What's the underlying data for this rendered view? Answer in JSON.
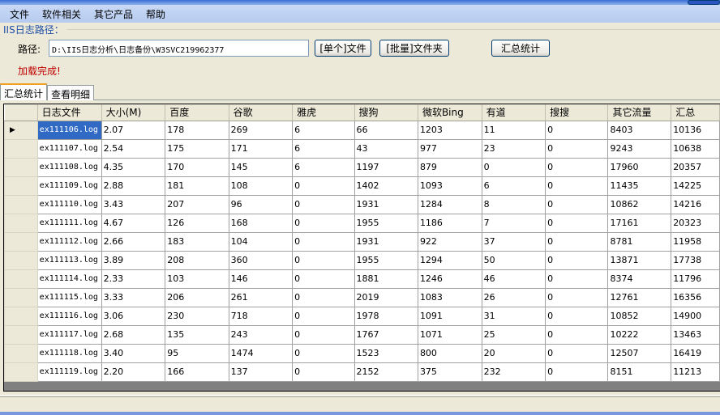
{
  "menu": [
    "文件",
    "软件相关",
    "其它产品",
    "帮助"
  ],
  "group_label": "IIS日志路径：",
  "path_label": "路径:",
  "path_value": "D:\\IIS日志分析\\日志备份\\W3SVC219962377",
  "buttons": {
    "single": "[单个]文件",
    "batch": "[批量]文件夹",
    "summary": "汇总统计"
  },
  "status": "加载完成!",
  "tabs": [
    "汇总统计",
    "查看明细"
  ],
  "columns": [
    "日志文件",
    "大小(M)",
    "百度",
    "谷歌",
    "雅虎",
    "搜狗",
    "微软Bing",
    "有道",
    "搜搜",
    "其它流量",
    "汇总"
  ],
  "rows": [
    [
      "ex111106.log",
      "2.07",
      "178",
      "269",
      "6",
      "66",
      "1203",
      "11",
      "0",
      "8403",
      "10136"
    ],
    [
      "ex111107.log",
      "2.54",
      "175",
      "171",
      "6",
      "43",
      "977",
      "23",
      "0",
      "9243",
      "10638"
    ],
    [
      "ex111108.log",
      "4.35",
      "170",
      "145",
      "6",
      "1197",
      "879",
      "0",
      "0",
      "17960",
      "20357"
    ],
    [
      "ex111109.log",
      "2.88",
      "181",
      "108",
      "0",
      "1402",
      "1093",
      "6",
      "0",
      "11435",
      "14225"
    ],
    [
      "ex111110.log",
      "3.43",
      "207",
      "96",
      "0",
      "1931",
      "1284",
      "8",
      "0",
      "10862",
      "14216"
    ],
    [
      "ex111111.log",
      "4.67",
      "126",
      "168",
      "0",
      "1955",
      "1186",
      "7",
      "0",
      "17161",
      "20323"
    ],
    [
      "ex111112.log",
      "2.66",
      "183",
      "104",
      "0",
      "1931",
      "922",
      "37",
      "0",
      "8781",
      "11958"
    ],
    [
      "ex111113.log",
      "3.89",
      "208",
      "360",
      "0",
      "1955",
      "1294",
      "50",
      "0",
      "13871",
      "17738"
    ],
    [
      "ex111114.log",
      "2.33",
      "103",
      "146",
      "0",
      "1881",
      "1246",
      "46",
      "0",
      "8374",
      "11796"
    ],
    [
      "ex111115.log",
      "3.33",
      "206",
      "261",
      "0",
      "2019",
      "1083",
      "26",
      "0",
      "12761",
      "16356"
    ],
    [
      "ex111116.log",
      "3.06",
      "230",
      "718",
      "0",
      "1978",
      "1091",
      "31",
      "0",
      "10852",
      "14900"
    ],
    [
      "ex111117.log",
      "2.68",
      "135",
      "243",
      "0",
      "1767",
      "1071",
      "25",
      "0",
      "10222",
      "13463"
    ],
    [
      "ex111118.log",
      "3.40",
      "95",
      "1474",
      "0",
      "1523",
      "800",
      "20",
      "0",
      "12507",
      "16419"
    ],
    [
      "ex111119.log",
      "2.20",
      "166",
      "137",
      "0",
      "2152",
      "375",
      "232",
      "0",
      "8151",
      "11213"
    ]
  ],
  "current_row_marker": "▶"
}
